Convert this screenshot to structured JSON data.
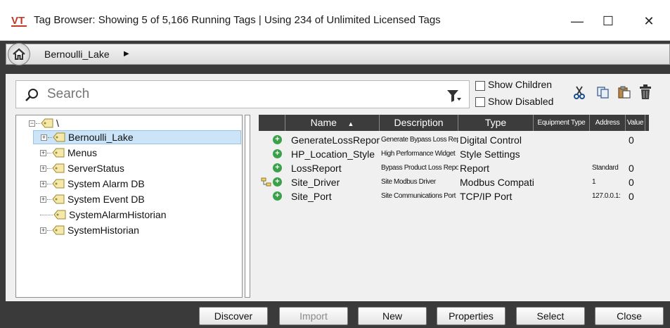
{
  "title_bar": {
    "title": "Tag Browser: Showing 5 of 5,166 Running Tags | Using 234 of Unlimited Licensed Tags",
    "minimize_symbol": "—",
    "maximize_symbol": "☐",
    "close_symbol": "✕",
    "logo_icon": "vts-logo-icon"
  },
  "breadcrumb": {
    "home_icon": "home-icon",
    "item": "Bernoulli_Lake",
    "arrow": "▶"
  },
  "search": {
    "placeholder": "Search",
    "value": ""
  },
  "options": {
    "show_children": "Show Children",
    "show_disabled": "Show Disabled",
    "show_children_checked": false,
    "show_disabled_checked": false
  },
  "toolbar_icons": [
    "cut-icon",
    "copy-icon",
    "paste-icon",
    "delete-icon"
  ],
  "tree": {
    "root": "\\",
    "items": [
      {
        "label": "Bernoulli_Lake",
        "expandable": true,
        "selected": true
      },
      {
        "label": "Menus",
        "expandable": true,
        "selected": false
      },
      {
        "label": "ServerStatus",
        "expandable": true,
        "selected": false
      },
      {
        "label": "System Alarm DB",
        "expandable": true,
        "selected": false
      },
      {
        "label": "System Event DB",
        "expandable": true,
        "selected": false
      },
      {
        "label": "SystemAlarmHistorian",
        "expandable": false,
        "selected": false
      },
      {
        "label": "SystemHistorian",
        "expandable": true,
        "selected": false
      }
    ]
  },
  "table": {
    "columns": [
      "Name",
      "Description",
      "Type",
      "Equipment Type",
      "Address",
      "Value"
    ],
    "sort_indicator": "▲",
    "rows": [
      {
        "name": "GenerateLossReport",
        "description": "Generate Bypass Loss Rep",
        "type": "Digital Control",
        "equipment_type": "",
        "address": "",
        "value": "0"
      },
      {
        "name": "HP_Location_Style",
        "description": "High Performance Widget",
        "type": "Style Settings",
        "equipment_type": "",
        "address": "",
        "value": ""
      },
      {
        "name": "LossReport",
        "description": "Bypass Product Loss Repo",
        "type": "Report",
        "equipment_type": "",
        "address": "Standard",
        "value": "0"
      },
      {
        "name": "Site_Driver",
        "description": "Site Modbus Driver",
        "type": "Modbus Compatible",
        "equipment_type": "",
        "address": "1",
        "value": "0"
      },
      {
        "name": "Site_Port",
        "description": "Site Communications Port",
        "type": "TCP/IP Port",
        "equipment_type": "",
        "address": "127.0.0.1:",
        "value": "0"
      }
    ]
  },
  "buttons": {
    "discover": "Discover",
    "import": "Import",
    "new": "New",
    "properties": "Properties",
    "select": "Select",
    "close": "Close"
  },
  "colors": {
    "accent_selected": "#cce4f7",
    "status_green": "#3aa14a",
    "header_dark": "#3c3c3c"
  }
}
